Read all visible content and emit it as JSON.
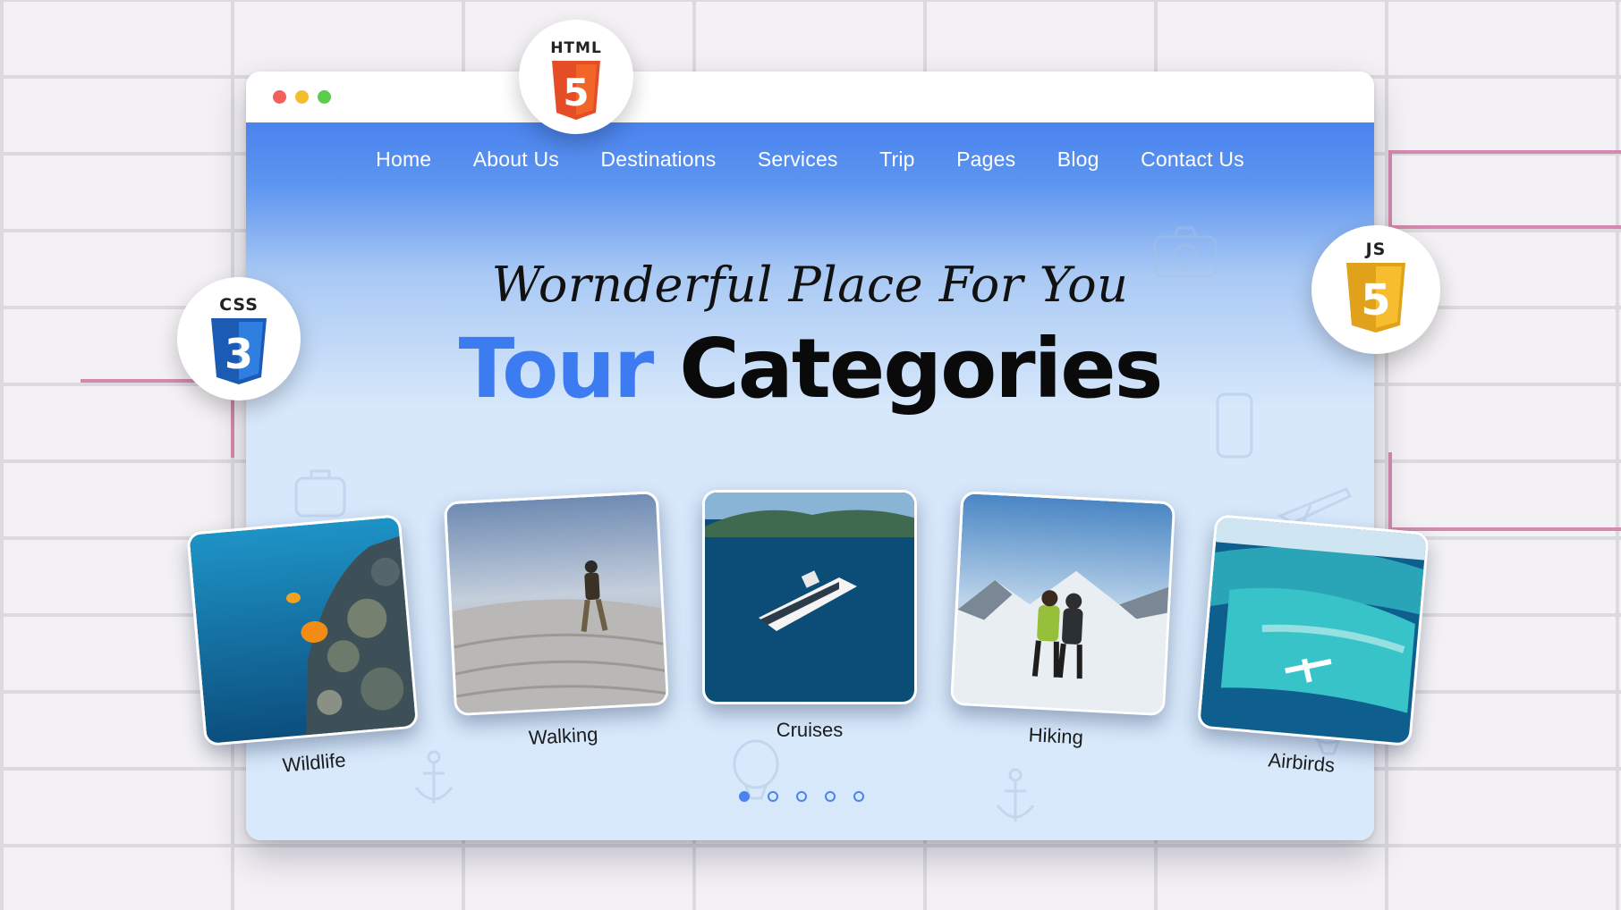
{
  "window": {
    "controls": [
      {
        "name": "close-dot",
        "color": "#f0625a"
      },
      {
        "name": "minimize-dot",
        "color": "#f3be2d"
      },
      {
        "name": "maximize-dot",
        "color": "#5acb4a"
      }
    ]
  },
  "nav": {
    "items": [
      "Home",
      "About Us",
      "Destinations",
      "Services",
      "Trip",
      "Pages",
      "Blog",
      "Contact Us"
    ]
  },
  "hero": {
    "script_title": "Wornderful Place For You",
    "title_part1": "Tour",
    "title_part2": "Categories"
  },
  "categories": [
    {
      "label": "Wildlife",
      "icon": "coral-reef-photo"
    },
    {
      "label": "Walking",
      "icon": "desert-walker-photo"
    },
    {
      "label": "Cruises",
      "icon": "cruise-ship-photo"
    },
    {
      "label": "Hiking",
      "icon": "mountain-hikers-photo"
    },
    {
      "label": "Airbirds",
      "icon": "seaplane-lagoon-photo"
    }
  ],
  "pagination": {
    "pages": 5,
    "active_page": 1
  },
  "badges": {
    "html": {
      "label": "HTML",
      "number": "5",
      "color": "#e44d26"
    },
    "css": {
      "label": "CSS",
      "number": "3",
      "color": "#2a6fd6"
    },
    "js": {
      "label": "JS",
      "number": "5",
      "color": "#f0b323"
    }
  },
  "colors": {
    "accent_blue": "#3d7bf0",
    "header_blue": "#4a83ee"
  }
}
